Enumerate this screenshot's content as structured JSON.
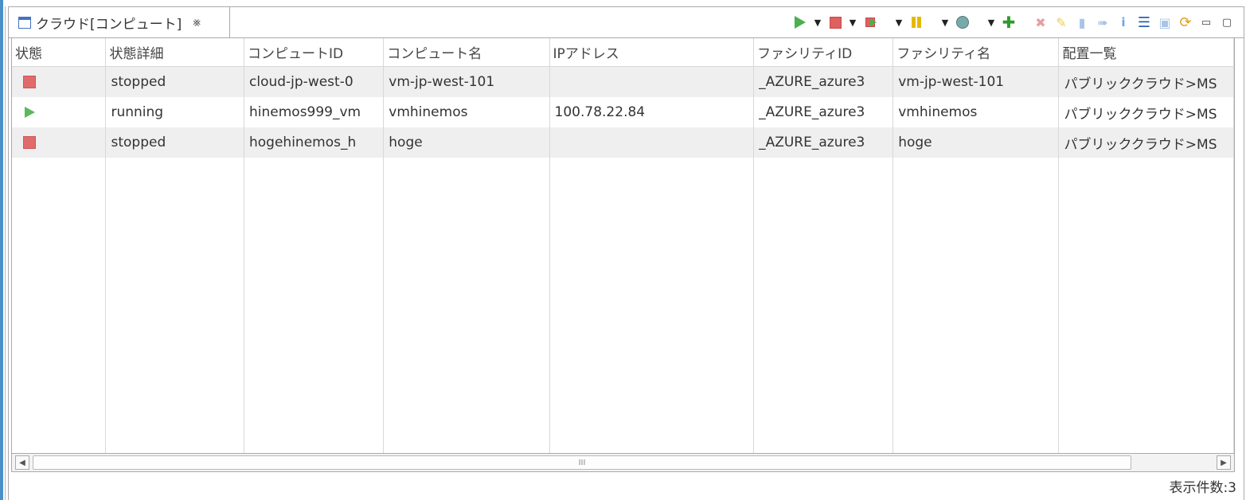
{
  "tab": {
    "title": "クラウド[コンピュート]",
    "close_glyph": "⨳"
  },
  "toolbar": {
    "icons": [
      "start-icon",
      "stop-icon",
      "stop-run-icon",
      "pause-icon",
      "snapshot-icon",
      "add-icon",
      "delete-icon",
      "edit-icon",
      "attach-icon",
      "detach-icon",
      "info-icon",
      "tree-icon",
      "assign-icon",
      "refresh-icon",
      "minimize-icon",
      "maximize-icon"
    ]
  },
  "table": {
    "columns": [
      "状態",
      "状態詳細",
      "コンピュートID",
      "コンピュート名",
      "IPアドレス",
      "ファシリティID",
      "ファシリティ名",
      "配置一覧"
    ],
    "rows": [
      {
        "status": "stopped",
        "detail": "stopped",
        "compute_id": "cloud-jp-west-0",
        "compute_name": "vm-jp-west-101",
        "ip": "",
        "facility_id": "_AZURE_azure3",
        "facility_name": "vm-jp-west-101",
        "placement": "パブリッククラウド>MS"
      },
      {
        "status": "running",
        "detail": "running",
        "compute_id": "hinemos999_vm",
        "compute_name": "vmhinemos",
        "ip": "100.78.22.84",
        "facility_id": "_AZURE_azure3",
        "facility_name": "vmhinemos",
        "placement": "パブリッククラウド>MS"
      },
      {
        "status": "stopped",
        "detail": "stopped",
        "compute_id": "hogehinemos_h",
        "compute_name": "hoge",
        "ip": "",
        "facility_id": "_AZURE_azure3",
        "facility_name": "hoge",
        "placement": "パブリッククラウド>MS"
      }
    ]
  },
  "scrollbar": {
    "grip": "III"
  },
  "footer": {
    "count_text": "表示件数:3"
  },
  "colors": {
    "stopped": "#e06b6b",
    "running": "#5cb85c",
    "accent": "#4a90c9"
  }
}
